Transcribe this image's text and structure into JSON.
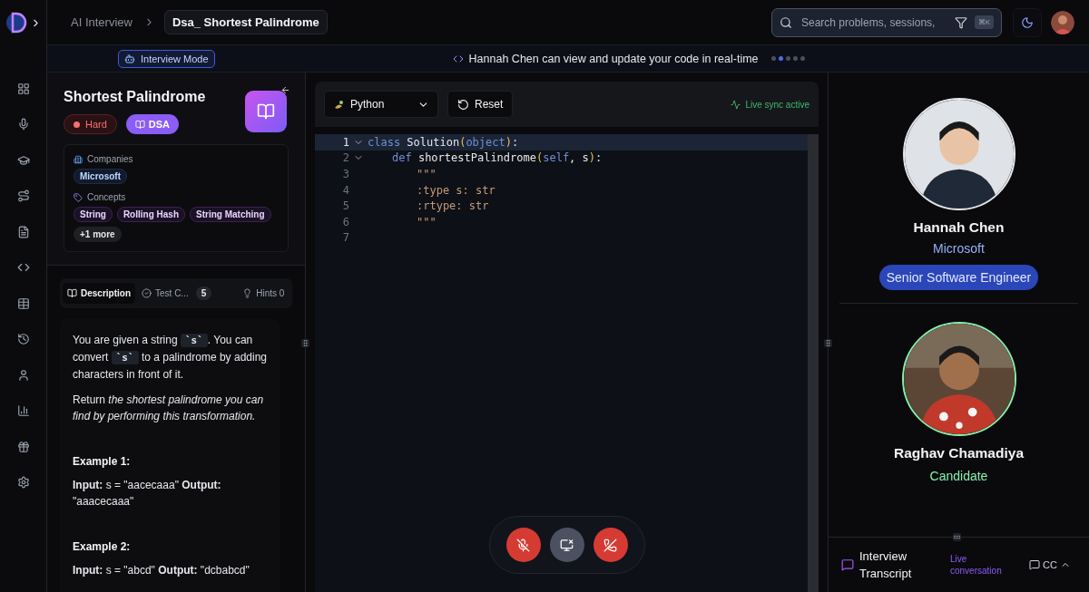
{
  "breadcrumb": {
    "parent": "AI Interview",
    "current": "Dsa_ Shortest Palindrome"
  },
  "search": {
    "placeholder": "Search problems, sessions,",
    "shortcut": "⌘K"
  },
  "mode_badge": "Interview Mode",
  "sync_banner": {
    "text": "Hannah Chen can view and update your code in real-time",
    "dots": [
      {
        "selected": false
      },
      {
        "selected": true
      },
      {
        "selected": false
      },
      {
        "selected": false
      },
      {
        "selected": false
      }
    ]
  },
  "problem": {
    "title": "Shortest Palindrome",
    "difficulty": "Hard",
    "category": "DSA",
    "companies_label": "Companies",
    "companies": [
      "Microsoft"
    ],
    "concepts_label": "Concepts",
    "concepts": [
      "String",
      "Rolling Hash",
      "String Matching"
    ],
    "more": "+1 more"
  },
  "tabs": [
    {
      "label": "Description",
      "selected": true
    },
    {
      "label": "Test C...",
      "badge": "5",
      "selected": false
    },
    {
      "label": "Hints 0",
      "selected": false
    }
  ],
  "description": [
    {
      "kind": "para",
      "segments": [
        {
          "kind": "text",
          "text": "You are given a string "
        },
        {
          "kind": "code",
          "text": "`s`"
        },
        {
          "kind": "text",
          "text": ". You can convert "
        },
        {
          "kind": "code",
          "text": "`s`"
        },
        {
          "kind": "text",
          "text": " to a palindrome by adding characters in front of it."
        }
      ]
    },
    {
      "kind": "rich",
      "text": "Return *the shortest palindrome you can find by performing this transformation.*"
    },
    {
      "kind": "heading",
      "text": "Example 1:"
    },
    {
      "kind": "rich",
      "text": "**Input:** s = \"aacecaaa\" **Output:** \"aaacecaaa\""
    },
    {
      "kind": "heading",
      "text": "Example 2:"
    },
    {
      "kind": "rich",
      "text": "**Input:** s = \"abcd\" **Output:** \"dcbabcd\""
    }
  ],
  "editor": {
    "language": "Python",
    "reset": "Reset",
    "status": "Live sync active",
    "lines": [
      {
        "number": "1",
        "active": true,
        "foldable": true,
        "tokens": [
          {
            "kind": "keyword",
            "text": "class"
          },
          {
            "kind": "plain",
            "text": " Solution"
          },
          {
            "kind": "paren",
            "text": "("
          },
          {
            "kind": "keyword",
            "text": "object"
          },
          {
            "kind": "paren",
            "text": ")"
          },
          {
            "kind": "plain",
            "text": ":"
          }
        ],
        "children": [
          {
            "number": "2",
            "active": false,
            "foldable": true,
            "tokens": [
              {
                "kind": "keyword",
                "text": "def"
              },
              {
                "kind": "plain",
                "text": " shortestPalindrome"
              },
              {
                "kind": "paren",
                "text": "("
              },
              {
                "kind": "keyword",
                "text": "self"
              },
              {
                "kind": "plain",
                "text": ", s"
              },
              {
                "kind": "paren",
                "text": ")"
              },
              {
                "kind": "plain",
                "text": ":"
              }
            ],
            "children": [
              {
                "number": "3",
                "active": false,
                "foldable": false,
                "tokens": [
                  {
                    "kind": "string",
                    "text": "\"\"\""
                  }
                ]
              },
              {
                "number": "4",
                "active": false,
                "foldable": false,
                "tokens": [
                  {
                    "kind": "string",
                    "text": ":type s: str"
                  }
                ]
              },
              {
                "number": "5",
                "active": false,
                "foldable": false,
                "tokens": [
                  {
                    "kind": "string",
                    "text": ":rtype: str"
                  }
                ]
              },
              {
                "number": "6",
                "active": false,
                "foldable": false,
                "tokens": [
                  {
                    "kind": "string",
                    "text": "\"\"\""
                  }
                ]
              }
            ]
          }
        ]
      },
      {
        "number": "7",
        "active": false,
        "foldable": false
      }
    ]
  },
  "call_controls": [
    {
      "kind": "mic"
    },
    {
      "kind": "screen"
    },
    {
      "kind": "hangup"
    }
  ],
  "participants": [
    {
      "name": "Hannah Chen",
      "company": "Microsoft",
      "role": "Senior Software Engineer",
      "kind": "interviewer"
    },
    {
      "name": "Raghav Chamadiya",
      "role": "Candidate",
      "kind": "candidate"
    }
  ],
  "transcript": {
    "title": "Interview Transcript",
    "status": "Live conversation",
    "cc": "CC"
  }
}
